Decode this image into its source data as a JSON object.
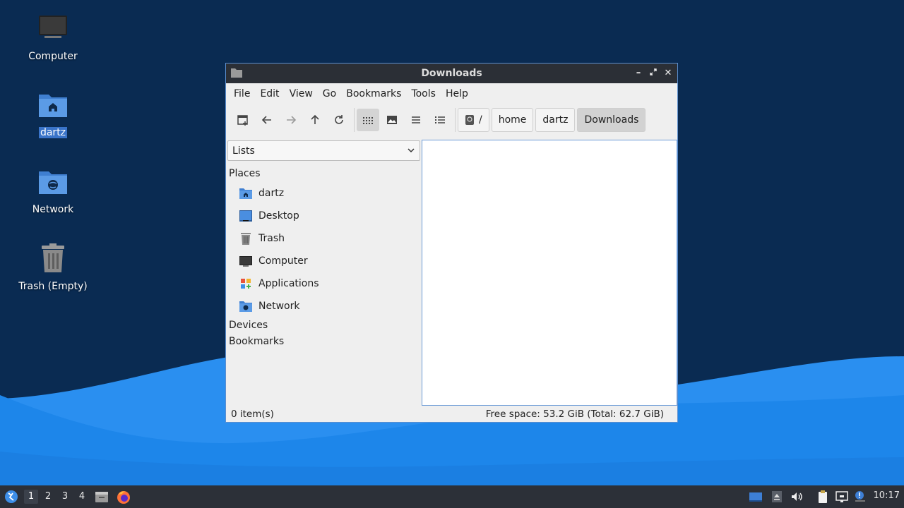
{
  "desktop": {
    "icons": [
      {
        "label": "Computer"
      },
      {
        "label": "dartz"
      },
      {
        "label": "Network"
      },
      {
        "label": "Trash (Empty)"
      }
    ]
  },
  "window": {
    "title": "Downloads",
    "menus": [
      "File",
      "Edit",
      "View",
      "Go",
      "Bookmarks",
      "Tools",
      "Help"
    ],
    "breadcrumb": [
      "/",
      "home",
      "dartz",
      "Downloads"
    ],
    "side_panel": {
      "mode": "Lists",
      "sections": {
        "places": "Places",
        "devices": "Devices",
        "bookmarks": "Bookmarks"
      },
      "places": [
        {
          "label": "dartz",
          "icon": "home-folder-icon"
        },
        {
          "label": "Desktop",
          "icon": "desktop-icon"
        },
        {
          "label": "Trash",
          "icon": "trash-icon"
        },
        {
          "label": "Computer",
          "icon": "computer-icon"
        },
        {
          "label": "Applications",
          "icon": "applications-icon"
        },
        {
          "label": "Network",
          "icon": "network-folder-icon"
        }
      ]
    },
    "status": {
      "items": "0 item(s)",
      "free_space": "Free space: 53.2 GiB (Total: 62.7 GiB)"
    }
  },
  "taskbar": {
    "workspaces": [
      "1",
      "2",
      "3",
      "4"
    ],
    "active_workspace": "1",
    "clock": "10:17"
  },
  "colors": {
    "desktop": "#0a2b52",
    "wave": "#1f8ee8",
    "selection": "#3a74c9",
    "taskbar": "#2c3038",
    "titlebar": "#2b2f36"
  }
}
